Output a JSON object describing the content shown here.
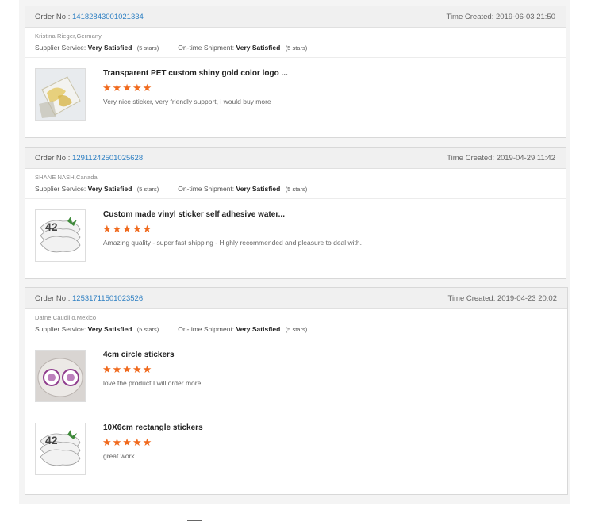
{
  "colors": {
    "link": "#2f80c3",
    "star": "#f06a1e",
    "header_bg": "#f0f0f0"
  },
  "reviews": [
    {
      "order_label": "Order No.:",
      "order_number": "14182843001021334",
      "created_label": "Time Created:",
      "created": "2019-06-03 21:50",
      "buyer": "Kristina Rieger,Germany",
      "supplier_label": "Supplier Service:",
      "supplier_value": "Very Satisfied",
      "supplier_stars": "(5 stars)",
      "shipment_label": "On-time Shipment:",
      "shipment_value": "Very Satisfied",
      "shipment_stars": "(5 stars)",
      "items": [
        {
          "title": "Transparent PET custom shiny gold color logo ...",
          "rating": 5,
          "stars": "★★★★★",
          "comment": "Very nice sticker, very friendly support, i would buy more",
          "image": "gold-sticker-photo"
        }
      ]
    },
    {
      "order_label": "Order No.:",
      "order_number": "12911242501025628",
      "created_label": "Time Created:",
      "created": "2019-04-29 11:42",
      "buyer": "SHANE NASH,Canada",
      "supplier_label": "Supplier Service:",
      "supplier_value": "Very Satisfied",
      "supplier_stars": "(5 stars)",
      "shipment_label": "On-time Shipment:",
      "shipment_value": "Very Satisfied",
      "shipment_stars": "(5 stars)",
      "items": [
        {
          "title": "Custom made vinyl sticker self adhesive water...",
          "rating": 5,
          "stars": "★★★★★",
          "comment": "Amazing quality - super fast shipping - Highly recommended and pleasure to deal with.",
          "image": "vinyl-sticker-photo"
        }
      ]
    },
    {
      "order_label": "Order No.:",
      "order_number": "12531711501023526",
      "created_label": "Time Created:",
      "created": "2019-04-23 20:02",
      "buyer": "Dafne Caudillo,Mexico",
      "supplier_label": "Supplier Service:",
      "supplier_value": "Very Satisfied",
      "supplier_stars": "(5 stars)",
      "shipment_label": "On-time Shipment:",
      "shipment_value": "Very Satisfied",
      "shipment_stars": "(5 stars)",
      "items": [
        {
          "title": "4cm circle stickers",
          "rating": 5,
          "stars": "★★★★★",
          "comment": "love the product I will order more",
          "image": "circle-sticker-roll-photo"
        },
        {
          "title": "10X6cm rectangle stickers",
          "rating": 5,
          "stars": "★★★★★",
          "comment": "great work",
          "image": "rectangle-sticker-photo"
        }
      ]
    }
  ]
}
